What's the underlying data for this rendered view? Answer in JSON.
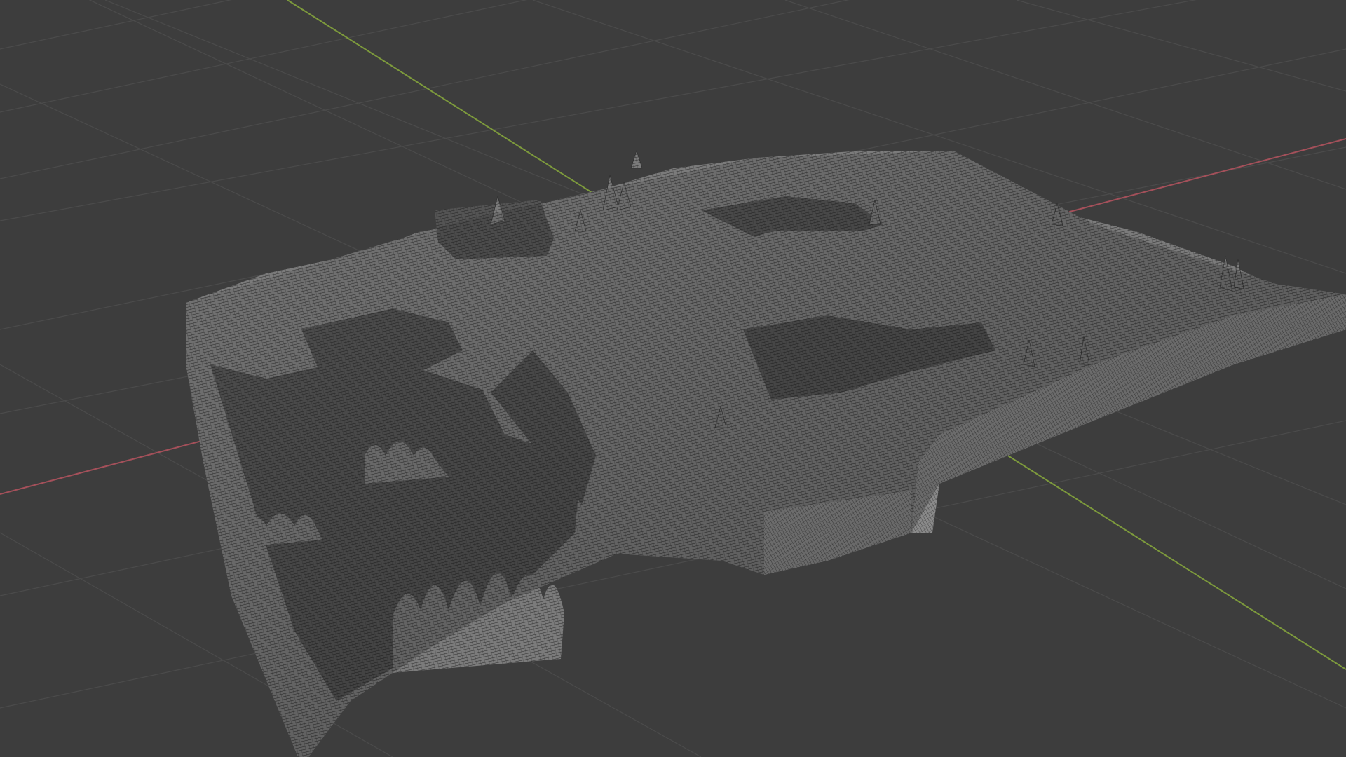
{
  "app": {
    "view": "3D Viewport",
    "shading": "wireframe-over-solid"
  },
  "scene": {
    "object_type": "terrain-mesh",
    "theme": {
      "background": "#3d3d3d",
      "grid_line": "#4a4a4a",
      "x_axis": "#a4505a",
      "y_axis": "#7d9a3c",
      "mesh_fill": "#7a7a7a",
      "mesh_shadow": "#2c2c2c",
      "mesh_wire": "#1c1c1c"
    }
  }
}
